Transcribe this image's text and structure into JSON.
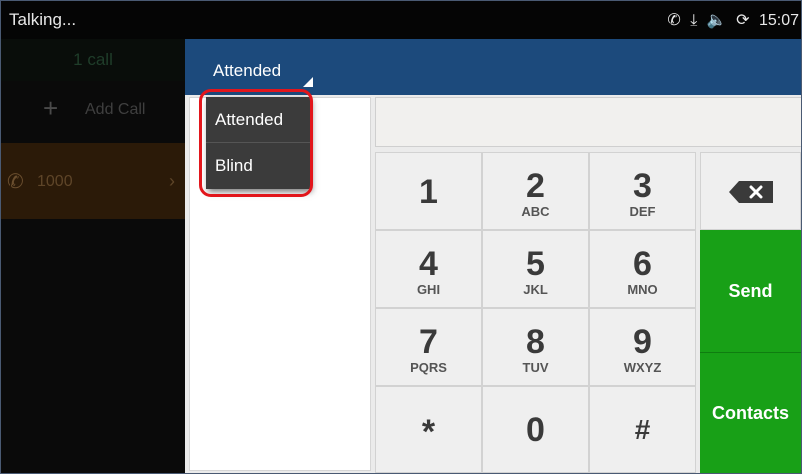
{
  "status_bar": {
    "title": "Talking...",
    "icons": [
      "call-forward-icon",
      "download-icon",
      "volume-icon",
      "sync-icon"
    ],
    "time": "15:07"
  },
  "left_panel": {
    "call_count": "1 call",
    "add_call_label": "Add Call",
    "call_item": {
      "number": "1000"
    }
  },
  "header": {
    "transfer_mode": "Attended"
  },
  "dropdown": {
    "options": [
      "Attended",
      "Blind"
    ]
  },
  "dialer": {
    "input_value": "",
    "keys": [
      {
        "digit": "1",
        "letters": ""
      },
      {
        "digit": "2",
        "letters": "ABC"
      },
      {
        "digit": "3",
        "letters": "DEF"
      },
      {
        "digit": "4",
        "letters": "GHI"
      },
      {
        "digit": "5",
        "letters": "JKL"
      },
      {
        "digit": "6",
        "letters": "MNO"
      },
      {
        "digit": "7",
        "letters": "PQRS"
      },
      {
        "digit": "8",
        "letters": "TUV"
      },
      {
        "digit": "9",
        "letters": "WXYZ"
      },
      {
        "digit": "*",
        "letters": ""
      },
      {
        "digit": "0",
        "letters": ""
      },
      {
        "digit": "#",
        "letters": ""
      }
    ],
    "send_label": "Send",
    "contacts_label": "Contacts"
  },
  "colors": {
    "header": "#1c4a7c",
    "action_green": "#18a017",
    "highlight_red": "#e2161c",
    "call_item_bg": "#2b1a08"
  }
}
